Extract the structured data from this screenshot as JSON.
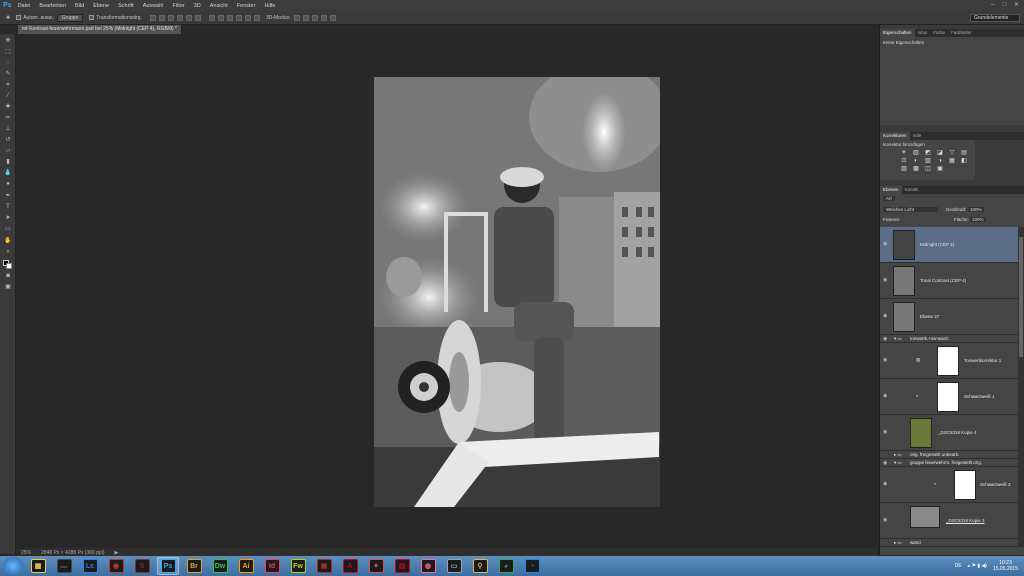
{
  "app": {
    "logo": "Ps"
  },
  "menu": [
    "Datei",
    "Bearbeiten",
    "Bild",
    "Ebene",
    "Schrift",
    "Auswahl",
    "Filter",
    "3D",
    "Ansicht",
    "Fenster",
    "Hilfe"
  ],
  "window_controls": [
    "–",
    "□",
    "✕"
  ],
  "options": {
    "auto_select_label": "Autom. ausw.:",
    "auto_select_value": "Gruppe",
    "transform_label": "Transformationsstrg.",
    "mode_3d": "3D-Modus:",
    "workspace": "Grundelemente"
  },
  "document": {
    "tab_title": "mf-Kontrast-feuerwehrmann.psd bei 25% (Midnight (CEP 4), RGB/8) *",
    "zoom": "25%",
    "doc_info": "2848 Px × 4288 Px (300 ppi)"
  },
  "properties_panel": {
    "tabs": [
      "Eigenschaften",
      "Infos",
      "Farbe",
      "Farbfelder"
    ],
    "message": "Keine Eigenschaften"
  },
  "adjustments_panel": {
    "tabs": [
      "Korrekturen",
      "Stile"
    ],
    "heading": "Korrektur hinzufügen",
    "icons": [
      "☀",
      "▥",
      "◩",
      "◪",
      "▽",
      "▤",
      "⚖",
      "◐",
      "▧",
      "◑",
      "▦",
      "◧",
      "▨",
      "▩",
      "◫",
      "▣"
    ]
  },
  "layers_panel": {
    "tabs": [
      "Ebenen",
      "Kanäle"
    ],
    "kind_filter": "Art",
    "blend_mode": "Weiches Licht",
    "opacity_label": "Deckkraft:",
    "opacity_value": "100%",
    "fill_label": "Fläche:",
    "fill_value": "100%",
    "fixieren_label": "Fixieren:",
    "layers": [
      {
        "name": "Midnight (CEP 4)",
        "selected": true
      },
      {
        "name": "Tonal Contrast (CEP 4)",
        "selected": false
      },
      {
        "name": "Ebene 27",
        "selected": false
      },
      {
        "name": "tonwertk.+sw-ward.",
        "selected": false
      },
      {
        "name": "Tonwertkorrektur 1",
        "selected": false
      },
      {
        "name": "Schwarzweiß 1",
        "selected": false
      },
      {
        "name": "_DSC5316 Kopie 4",
        "selected": false
      },
      {
        "name": "orig. freigestellt unbearb.",
        "selected": false
      },
      {
        "name": "gruppe feuerwehrm. freigestellt orig.",
        "selected": false
      },
      {
        "name": "Schwarzweiß 3",
        "selected": false
      },
      {
        "name": "_DSC5316 Kopie 3",
        "selected": false
      },
      {
        "name": "wand",
        "selected": false
      }
    ]
  },
  "taskbar": {
    "apps": [
      {
        "label": "▦",
        "color": "#f2c94c"
      },
      {
        "label": "▬",
        "color": "#444444"
      },
      {
        "label": "Lc",
        "color": "#2f80ed"
      },
      {
        "label": "◉",
        "color": "#c0392b"
      },
      {
        "label": "S",
        "color": "#8e2b2b"
      },
      {
        "label": "Ps",
        "color": "#31a8ff"
      },
      {
        "label": "Br",
        "color": "#e6a31c"
      },
      {
        "label": "Dw",
        "color": "#35c24a"
      },
      {
        "label": "Ai",
        "color": "#ff9a00"
      },
      {
        "label": "Id",
        "color": "#ff3366"
      },
      {
        "label": "Fw",
        "color": "#b7d41b"
      },
      {
        "label": "▣",
        "color": "#b02a2a"
      },
      {
        "label": "A",
        "color": "#d0021b"
      },
      {
        "label": "✦",
        "color": "#e05050"
      },
      {
        "label": "▤",
        "color": "#d0021b"
      },
      {
        "label": "◍",
        "color": "#ff6699"
      },
      {
        "label": "▭",
        "color": "#9aa5b1"
      },
      {
        "label": "⚲",
        "color": "#e8b04a"
      },
      {
        "label": "◕",
        "color": "#34a853"
      },
      {
        "label": "◔",
        "color": "#1e88e5"
      }
    ],
    "lang": "DE",
    "time": "10:23",
    "date": "15.05.2015"
  }
}
